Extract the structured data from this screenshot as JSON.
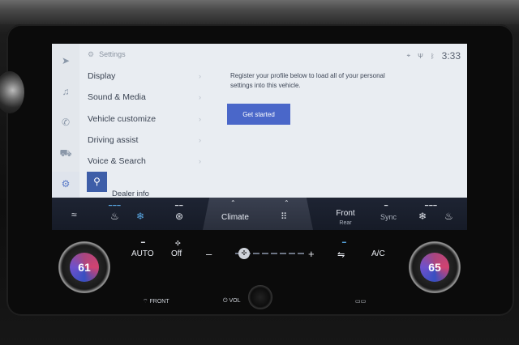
{
  "status": {
    "time": "3:33",
    "icons": [
      "location-icon",
      "antenna-icon",
      "bluetooth-icon"
    ]
  },
  "settings": {
    "title": "Settings",
    "menu": [
      {
        "label": "Display"
      },
      {
        "label": "Sound & Media"
      },
      {
        "label": "Vehicle customize"
      },
      {
        "label": "Driving assist"
      },
      {
        "label": "Voice & Search"
      },
      {
        "label": "Dealer info"
      }
    ]
  },
  "profile": {
    "message": "Register your profile below to load all of your personal settings into this vehicle.",
    "button": "Get started"
  },
  "climate_bar": {
    "climate_label": "Climate",
    "front_label": "Front",
    "rear_label": "Rear",
    "sync_label": "Sync"
  },
  "hvac": {
    "auto_label": "AUTO",
    "fan_label": "Off",
    "minus": "–",
    "plus": "+",
    "ac_label": "A/C",
    "left_temp": "61",
    "right_temp": "65"
  },
  "hardkeys": {
    "front_label": "FRONT",
    "vol_label": "VOL"
  },
  "colors": {
    "accent": "#4a67c9",
    "search_btn": "#3e5ea8",
    "temp_indicator": "#5aa9e6"
  }
}
